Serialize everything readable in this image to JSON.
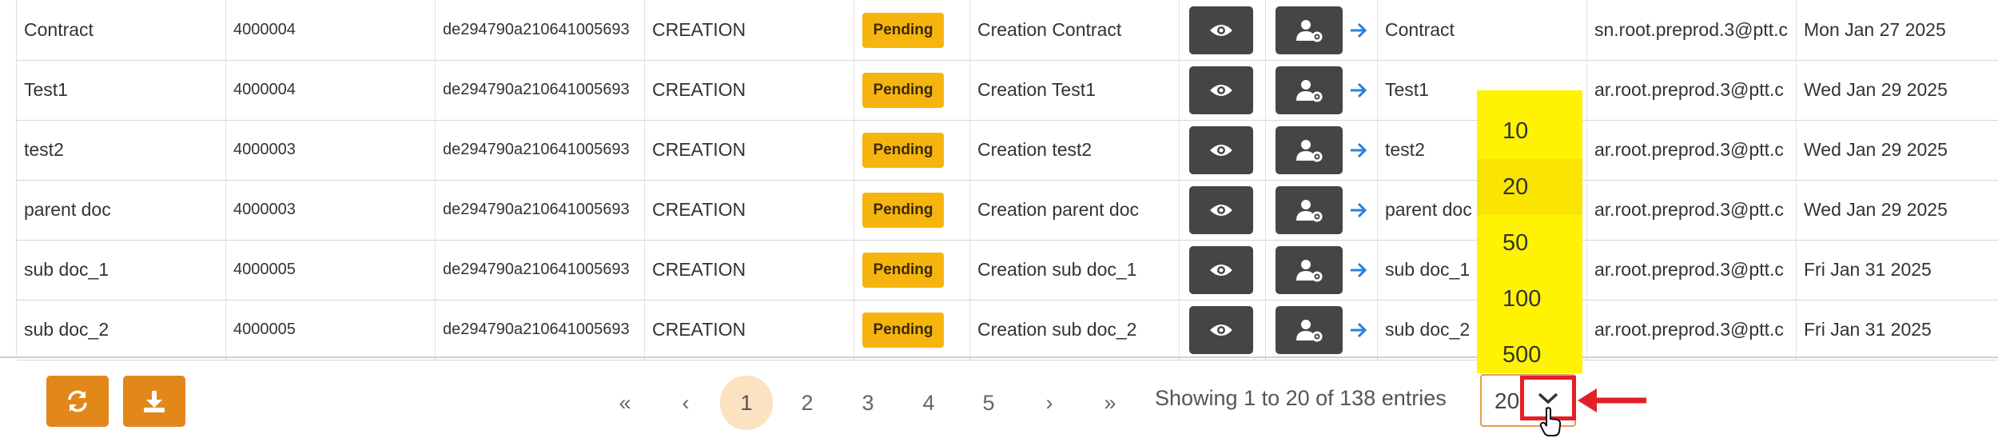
{
  "rows": [
    {
      "name": "Contract",
      "code": "4000004",
      "hash": "de294790a210641005693",
      "action": "CREATION",
      "status": "Pending",
      "description": "Creation Contract",
      "target": "Contract",
      "email": "sn.root.preprod.3@ptt.c",
      "date": "Mon Jan 27 2025"
    },
    {
      "name": "Test1",
      "code": "4000004",
      "hash": "de294790a210641005693",
      "action": "CREATION",
      "status": "Pending",
      "description": "Creation Test1",
      "target": "Test1",
      "email": "ar.root.preprod.3@ptt.c",
      "date": "Wed Jan 29 2025"
    },
    {
      "name": "test2",
      "code": "4000003",
      "hash": "de294790a210641005693",
      "action": "CREATION",
      "status": "Pending",
      "description": "Creation test2",
      "target": "test2",
      "email": "ar.root.preprod.3@ptt.c",
      "date": "Wed Jan 29 2025"
    },
    {
      "name": "parent doc",
      "code": "4000003",
      "hash": "de294790a210641005693",
      "action": "CREATION",
      "status": "Pending",
      "description": "Creation parent doc",
      "target": "parent doc",
      "email": "ar.root.preprod.3@ptt.c",
      "date": "Wed Jan 29 2025"
    },
    {
      "name": "sub doc_1",
      "code": "4000005",
      "hash": "de294790a210641005693",
      "action": "CREATION",
      "status": "Pending",
      "description": "Creation sub doc_1",
      "target": "sub doc_1",
      "email": "ar.root.preprod.3@ptt.c",
      "date": "Fri Jan 31 2025"
    },
    {
      "name": "sub doc_2",
      "code": "4000005",
      "hash": "de294790a210641005693",
      "action": "CREATION",
      "status": "Pending",
      "description": "Creation sub doc_2",
      "target": "sub doc_2",
      "email": "ar.root.preprod.3@ptt.c",
      "date": "Fri Jan 31 2025"
    }
  ],
  "pagination": {
    "first": "«",
    "prev": "‹",
    "pages": [
      "1",
      "2",
      "3",
      "4",
      "5"
    ],
    "active_page": "1",
    "next": "›",
    "last": "»",
    "info": "Showing 1 to 20 of 138 entries"
  },
  "page_size": {
    "value": "20",
    "options": [
      "10",
      "20",
      "50",
      "100",
      "500"
    ],
    "selected": "20"
  },
  "icons": {
    "view": "eye-icon",
    "settings": "user-gear-icon",
    "go": "arrow-right-icon",
    "refresh": "refresh-icon",
    "download": "download-icon",
    "chevron": "chevron-down-icon",
    "cursor": "hand-pointer-icon",
    "annotation": "red-arrow-left-icon"
  },
  "colors": {
    "badge": "#f6b50e",
    "action_button": "#454545",
    "orange_button": "#e2881b",
    "highlight": "#e32027",
    "dropdown": "#fff301",
    "link_arrow": "#2a7fd9"
  }
}
